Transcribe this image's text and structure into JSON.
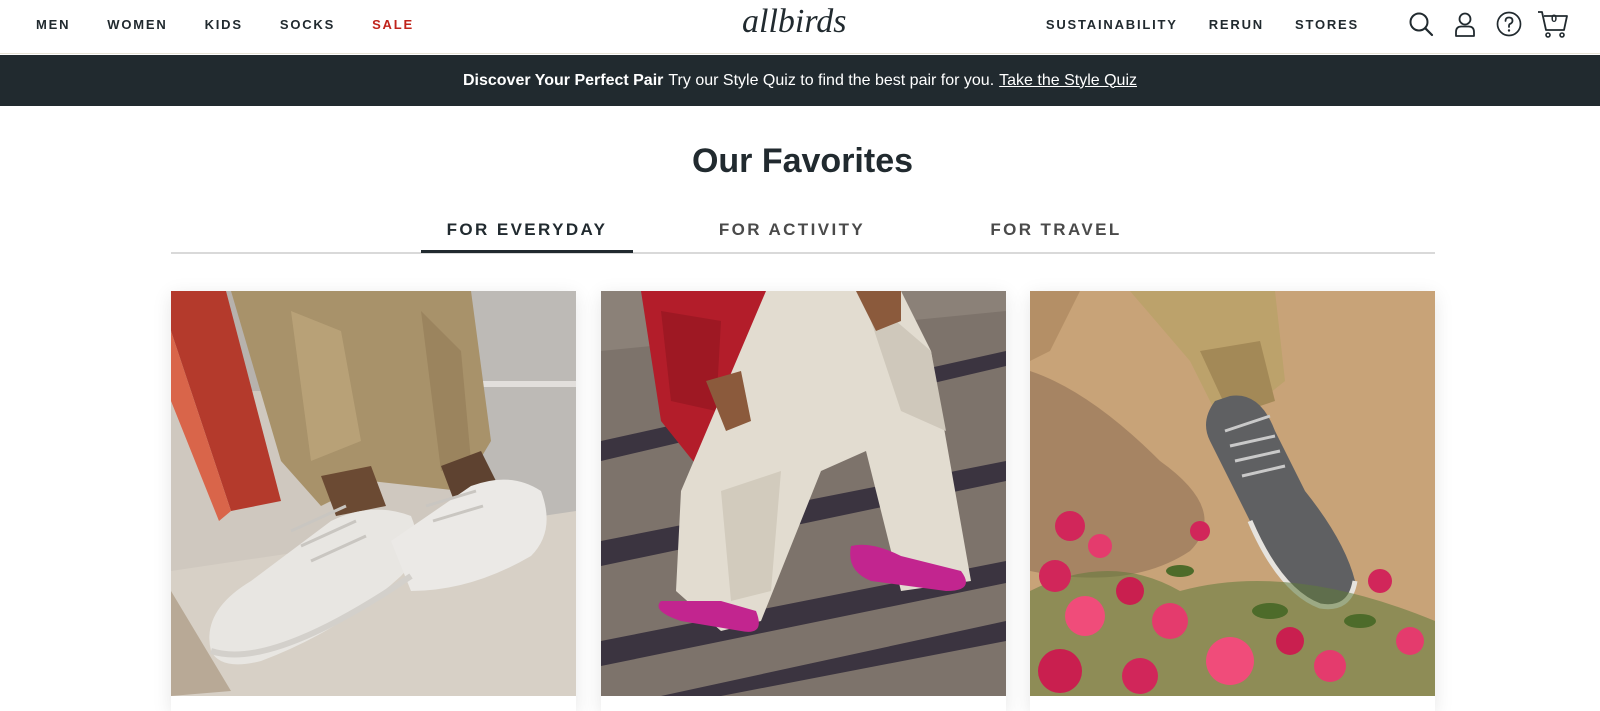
{
  "nav": {
    "left": [
      {
        "label": "MEN",
        "name": "nav-men"
      },
      {
        "label": "WOMEN",
        "name": "nav-women"
      },
      {
        "label": "KIDS",
        "name": "nav-kids"
      },
      {
        "label": "SOCKS",
        "name": "nav-socks"
      },
      {
        "label": "SALE",
        "name": "nav-sale"
      }
    ],
    "logo": "allbirds",
    "right": [
      {
        "label": "SUSTAINABILITY",
        "name": "nav-sustainability"
      },
      {
        "label": "RERUN",
        "name": "nav-rerun"
      },
      {
        "label": "STORES",
        "name": "nav-stores"
      }
    ],
    "icons": [
      "search-icon",
      "account-icon",
      "help-icon",
      "cart-icon"
    ],
    "cart_count": "0"
  },
  "promo": {
    "bold": "Discover Your Perfect Pair",
    "text": "Try our Style Quiz to find the best pair for you.",
    "link": "Take the Style Quiz"
  },
  "favorites": {
    "title": "Our Favorites",
    "tabs": [
      {
        "label": "FOR EVERYDAY",
        "active": true
      },
      {
        "label": "FOR ACTIVITY",
        "active": false
      },
      {
        "label": "FOR TRAVEL",
        "active": false
      }
    ],
    "cards": [
      {
        "image": "white-knit-sneakers-photo"
      },
      {
        "image": "magenta-flats-photo"
      },
      {
        "image": "gray-wool-runners-photo"
      }
    ]
  },
  "colors": {
    "text": "#212a2f",
    "sale": "#c0231b",
    "banner": "#212a2f",
    "tab_border": "#d9d9d9"
  }
}
